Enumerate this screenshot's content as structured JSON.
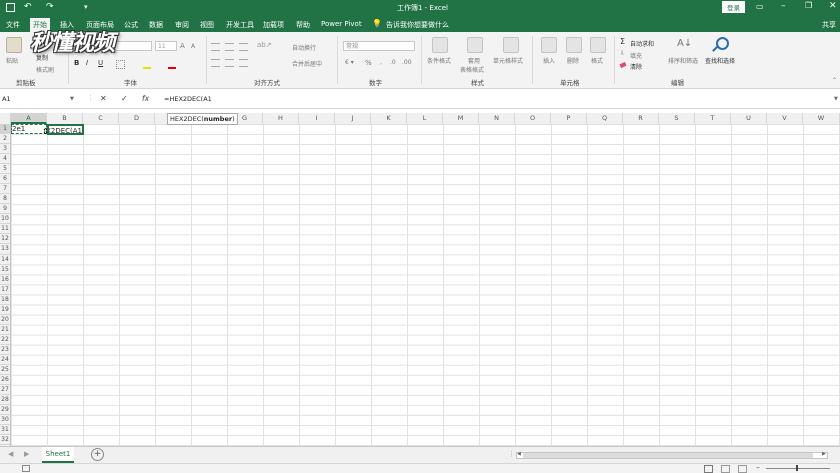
{
  "title_bar": {
    "window_title": "工作簿1 - Excel",
    "login_label": "登录"
  },
  "ribbon_tabs": [
    "文件",
    "开始",
    "插入",
    "页面布局",
    "公式",
    "数据",
    "审阅",
    "视图",
    "开发工具",
    "加载项",
    "帮助",
    "Power Pivot"
  ],
  "tell_me": "告诉我你想要做什么",
  "share_label": "共享",
  "watermark": "秒懂视频",
  "ribbon": {
    "clipboard": {
      "paste": "粘贴",
      "cut": "剪切",
      "copy": "复制",
      "format_painter": "格式刷",
      "group": "剪贴板"
    },
    "font": {
      "font_size": "11",
      "bold": "B",
      "italic": "I",
      "underline": "U",
      "grow": "A",
      "shrink": "A",
      "group": "字体"
    },
    "alignment": {
      "wrap": "自动换行",
      "merge": "合并后居中",
      "group": "对齐方式"
    },
    "number": {
      "format": "常规",
      "percent": "%",
      "group": "数字"
    },
    "styles": {
      "conditional": "条件格式",
      "table": "套用",
      "table2": "表格格式",
      "cell_styles": "单元格样式",
      "group": "样式"
    },
    "cells": {
      "insert": "插入",
      "delete": "删除",
      "format": "格式",
      "group": "单元格"
    },
    "editing": {
      "autosum": "自动求和",
      "fill": "填充",
      "clear": "清除",
      "sort": "排序和筛选",
      "find": "查找和选择",
      "group": "编辑"
    }
  },
  "formula_bar": {
    "name_box": "A1",
    "cancel": "✕",
    "enter": "✓",
    "fx": "fx",
    "formula": "=HEX2DEC(A1"
  },
  "tooltip": {
    "func": "HEX2DEC(",
    "arg": "number",
    ")": ")"
  },
  "columns": [
    "A",
    "B",
    "C",
    "D",
    "E",
    "F",
    "G",
    "H",
    "I",
    "J",
    "K",
    "L",
    "M",
    "N",
    "O",
    "P",
    "Q",
    "R",
    "S",
    "T",
    "U",
    "V",
    "W"
  ],
  "rows": [
    "1",
    "2",
    "3",
    "4",
    "5",
    "6",
    "7",
    "8",
    "9",
    "10",
    "11",
    "12",
    "13",
    "14",
    "15",
    "16",
    "17",
    "18",
    "19",
    "20",
    "21",
    "22",
    "23",
    "24",
    "25",
    "26",
    "27",
    "28",
    "29",
    "30",
    "31",
    "32"
  ],
  "cells": {
    "A1": "2e1",
    "B1": "=HEX2DEC(A1"
  },
  "sheet_tab": "Sheet1",
  "add_sheet": "+"
}
